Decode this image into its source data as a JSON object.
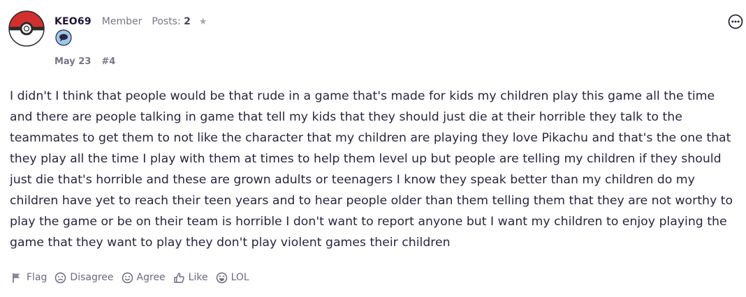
{
  "post": {
    "author": {
      "username": "KEO69",
      "role": "Member",
      "posts_label": "Posts:",
      "posts_count": "2",
      "rank_icon": "star-icon",
      "badge_icon": "speech-bubble-icon"
    },
    "date": "May 23",
    "post_number": "#4",
    "body": "I didn't I think that people would be that rude in a game that's made for kids my children play this game all the time and there are people talking in game that tell my kids that they should just die at their horrible they talk to the teammates to get them to not like the character that my children are playing they love Pikachu and that's the one that they play all the time I play with them at times to help them level up but people are telling my children if they should just die that's horrible and these are grown adults or teenagers I know they speak better than my children do my children have yet to reach their teen years and to hear people older than them telling them that they are not worthy to play the game or be on their team is horrible I don't want to report anyone but I want my children to enjoy playing the game that they want to play they don't play violent games their children"
  },
  "reactions": {
    "flag": "Flag",
    "disagree": "Disagree",
    "agree": "Agree",
    "like": "Like",
    "lol": "LOL"
  },
  "colors": {
    "text": "#2b2540",
    "muted": "#7a7488",
    "avatar_red": "#d42f2f",
    "badge_blue": "#9fc7ea"
  }
}
